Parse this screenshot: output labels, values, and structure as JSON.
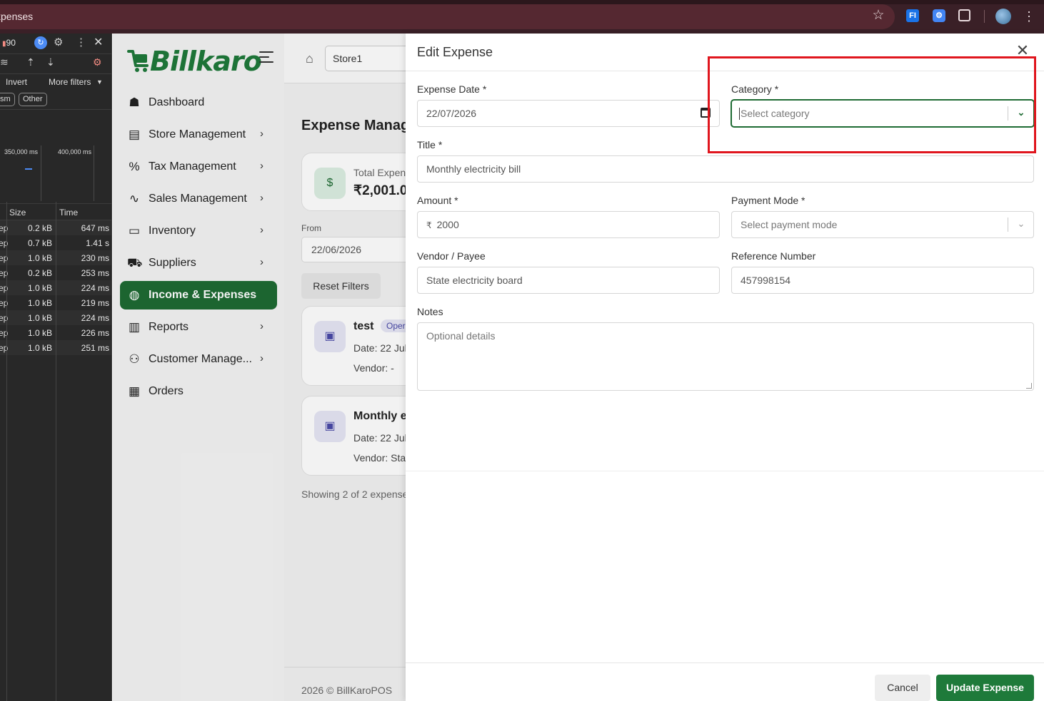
{
  "browser": {
    "tab_title": "xpenses",
    "extension1": "FI",
    "extension2": "⚙"
  },
  "devtools": {
    "message_count": "90",
    "invert_label": "Invert",
    "more_filters_label": "More filters",
    "chips": [
      "sm",
      "Other"
    ],
    "timeline_labels": [
      "350,000 ms",
      "400,000 ms"
    ],
    "columns": {
      "size": "Size",
      "time": "Time"
    },
    "rows": [
      {
        "prefix": "ep",
        "size": "0.2 kB",
        "time": "647 ms"
      },
      {
        "prefix": "ep",
        "size": "0.7 kB",
        "time": "1.41 s"
      },
      {
        "prefix": "ep",
        "size": "1.0 kB",
        "time": "230 ms"
      },
      {
        "prefix": "ep",
        "size": "0.2 kB",
        "time": "253 ms"
      },
      {
        "prefix": "ep",
        "size": "1.0 kB",
        "time": "224 ms"
      },
      {
        "prefix": "ep",
        "size": "1.0 kB",
        "time": "219 ms"
      },
      {
        "prefix": "ep",
        "size": "1.0 kB",
        "time": "224 ms"
      },
      {
        "prefix": "ep",
        "size": "1.0 kB",
        "time": "226 ms"
      },
      {
        "prefix": "ep",
        "size": "1.0 kB",
        "time": "251 ms"
      }
    ]
  },
  "app": {
    "logo_text": "Billkaro",
    "store_name": "Store1",
    "nav": [
      {
        "label": "Dashboard",
        "icon": "dashboard-icon",
        "glyph": "☗",
        "chevron": ""
      },
      {
        "label": "Store Management",
        "icon": "store-icon",
        "glyph": "▤",
        "chevron": "›"
      },
      {
        "label": "Tax Management",
        "icon": "percent-icon",
        "glyph": "%",
        "chevron": "›"
      },
      {
        "label": "Sales Management",
        "icon": "sales-icon",
        "glyph": "∿",
        "chevron": "›"
      },
      {
        "label": "Inventory",
        "icon": "inventory-icon",
        "glyph": "▭",
        "chevron": "›"
      },
      {
        "label": "Suppliers",
        "icon": "truck-icon",
        "glyph": "⛟",
        "chevron": "›"
      },
      {
        "label": "Income & Expenses",
        "icon": "income-expenses-icon",
        "glyph": "◍",
        "chevron": ""
      },
      {
        "label": "Reports",
        "icon": "bar-chart-icon",
        "glyph": "▥",
        "chevron": "›"
      },
      {
        "label": "Customer Manage...",
        "icon": "customers-icon",
        "glyph": "⚇",
        "chevron": "›"
      },
      {
        "label": "Orders",
        "icon": "orders-icon",
        "glyph": "▦",
        "chevron": ""
      }
    ],
    "page_title": "Expense Manag",
    "total_card": {
      "label": "Total Expen",
      "value": "₹2,001.0"
    },
    "from_label": "From",
    "from_value": "22/06/2026",
    "reset_filters": "Reset Filters",
    "expenses": [
      {
        "name": "test",
        "badge": "Oper",
        "date": "Date: 22 Jul",
        "vendor": "Vendor: -"
      },
      {
        "name": "Monthly e",
        "badge": "",
        "date": "Date: 22 Jul",
        "vendor": "Vendor: Sta"
      }
    ],
    "showing": "Showing 2 of 2 expense",
    "footer": "2026 © BillKaroPOS"
  },
  "drawer": {
    "title": "Edit Expense",
    "expense_date": {
      "label": "Expense Date *",
      "value": "22/07/2026"
    },
    "category": {
      "label": "Category *",
      "placeholder": "Select category"
    },
    "title_field": {
      "label": "Title *",
      "value": "Monthly electricity bill"
    },
    "amount": {
      "label": "Amount *",
      "currency": "₹",
      "value": "2000"
    },
    "payment_mode": {
      "label": "Payment Mode *",
      "placeholder": "Select payment mode"
    },
    "vendor": {
      "label": "Vendor / Payee",
      "value": "State electricity board"
    },
    "reference": {
      "label": "Reference Number",
      "value": "457998154"
    },
    "notes": {
      "label": "Notes",
      "placeholder": "Optional details"
    },
    "cancel": "Cancel",
    "update": "Update Expense"
  },
  "colors": {
    "brand_green": "#1e6b33",
    "highlight_red": "#e0161e"
  }
}
